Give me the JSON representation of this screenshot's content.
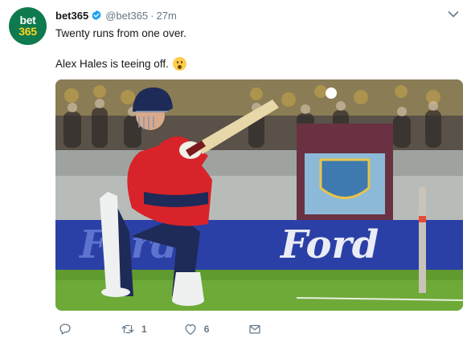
{
  "tweet": {
    "author_name": "bet365",
    "author_handle": "@bet365",
    "separator": "·",
    "timestamp": "27m",
    "avatar_line1": "bet",
    "avatar_line2": "365",
    "text_line1": "Twenty runs from one over.",
    "text_line2": "Alex Hales is teeing off.",
    "emoji": "hushed-face-emoji",
    "media": {
      "description_icon": "cricket-photo",
      "ad_board_text": "Ford",
      "accent_color": "#d0102a"
    },
    "actions": {
      "reply_icon": "reply-icon",
      "retweet_icon": "retweet-icon",
      "retweet_count": "1",
      "like_icon": "heart-icon",
      "like_count": "6",
      "dm_icon": "envelope-icon"
    }
  },
  "colors": {
    "verified": "#1da1f2",
    "muted": "#657786",
    "brand_green": "#0e7a4e",
    "brand_yellow": "#ffd21f"
  }
}
